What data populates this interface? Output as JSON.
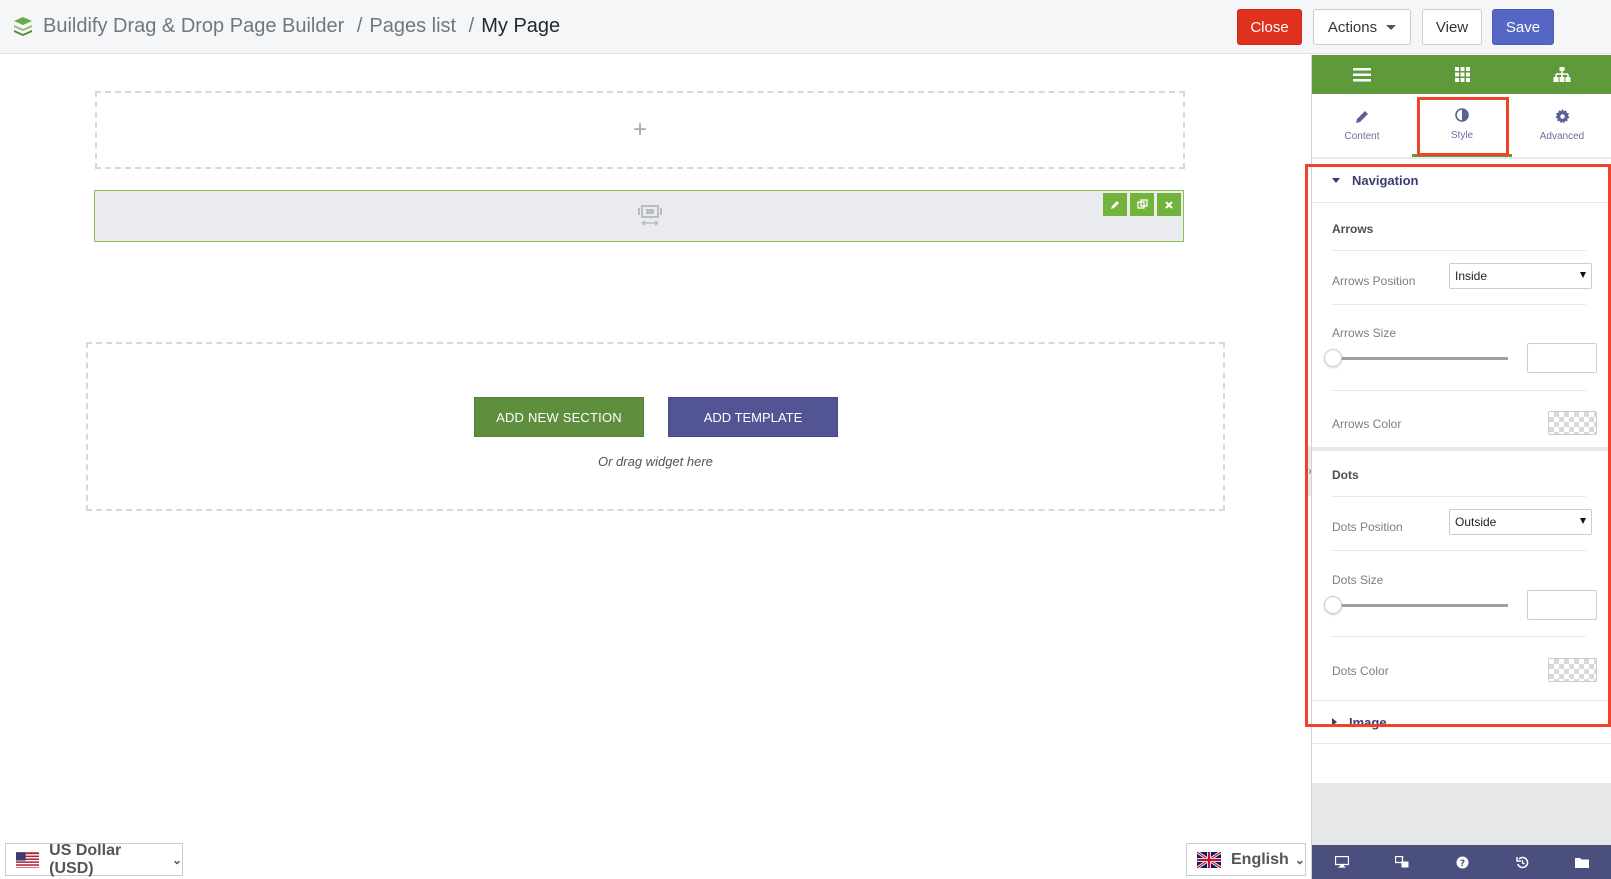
{
  "header": {
    "breadcrumb": {
      "app": "Buildify Drag & Drop Page Builder",
      "pages_list": "Pages list",
      "current": "My Page",
      "separator": "/"
    },
    "buttons": {
      "close": "Close",
      "actions": "Actions",
      "view": "View",
      "save": "Save"
    }
  },
  "canvas": {
    "add_icon": "+",
    "add_new_section": "ADD NEW SECTION",
    "add_template": "ADD TEMPLATE",
    "drag_hint": "Or drag widget here"
  },
  "footer_left": {
    "currency": "US Dollar (USD)"
  },
  "footer_right": {
    "language": "English"
  },
  "panel": {
    "tabs": [
      {
        "label": "Content",
        "icon": "pencil-icon"
      },
      {
        "label": "Style",
        "icon": "contrast-icon"
      },
      {
        "label": "Advanced",
        "icon": "gear-icon"
      }
    ],
    "active_tab": "Style",
    "sections": {
      "navigation": {
        "title": "Navigation",
        "arrows": {
          "heading": "Arrows",
          "position_label": "Arrows Position",
          "position_value": "Inside",
          "size_label": "Arrows Size",
          "size_value": 0,
          "color_label": "Arrows Color"
        },
        "dots": {
          "heading": "Dots",
          "position_label": "Dots Position",
          "position_value": "Outside",
          "size_label": "Dots Size",
          "size_value": 0,
          "color_label": "Dots Color"
        }
      },
      "image": {
        "title": "Image"
      }
    }
  },
  "colors": {
    "accent_green": "#5e9a3a",
    "close_red": "#e0301e",
    "save_blue": "#5566c4",
    "template_purple": "#535493",
    "highlight_red": "#f0442a",
    "panel_footer": "#4b4f7e"
  }
}
